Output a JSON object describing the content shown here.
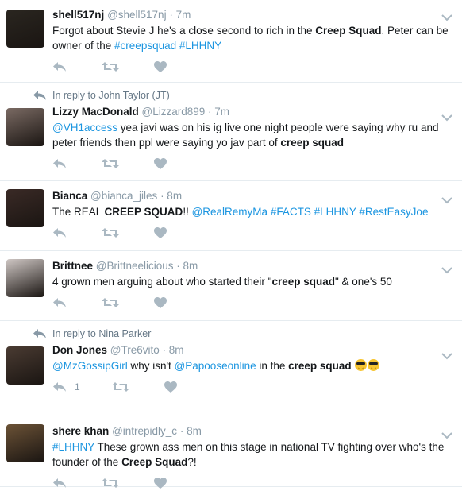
{
  "tweets": [
    {
      "reply_to": "",
      "name": "shell517nj",
      "handle": "@shell517nj",
      "time": "· 7m",
      "avatar_color": "#2a2620",
      "segments": [
        {
          "t": "Forgot about Stevie J he's a close second to rich in the "
        },
        {
          "t": "Creep Squad",
          "b": true
        },
        {
          "t": ".   Peter can be owner of the "
        },
        {
          "t": "#creepsquad",
          "l": true
        },
        {
          "t": "  "
        },
        {
          "t": "#LHHNY",
          "l": true
        }
      ],
      "reply_count": ""
    },
    {
      "reply_to": "In reply to John Taylor (JT)",
      "name": "Lizzy MacDonald",
      "handle": "@Lizzard899",
      "time": "· 7m",
      "avatar_color": "#7a6a63",
      "segments": [
        {
          "t": "@VH1access",
          "l": true
        },
        {
          "t": " yea javi was on his ig live one night people were saying why ru and peter friends then ppl were saying yo jav part of "
        },
        {
          "t": "creep squad",
          "b": true
        }
      ],
      "reply_count": ""
    },
    {
      "reply_to": "",
      "name": "Bianca",
      "handle": "@bianca_jiles",
      "time": "· 8m",
      "avatar_color": "#3a2a26",
      "segments": [
        {
          "t": "The REAL "
        },
        {
          "t": "CREEP SQUAD",
          "b": true
        },
        {
          "t": "!! "
        },
        {
          "t": "@RealRemyMa",
          "l": true
        },
        {
          "t": " "
        },
        {
          "t": "#FACTS",
          "l": true
        },
        {
          "t": " "
        },
        {
          "t": "#LHHNY",
          "l": true
        },
        {
          "t": " "
        },
        {
          "t": "#RestEasyJoe",
          "l": true
        }
      ],
      "reply_count": ""
    },
    {
      "reply_to": "",
      "name": "Brittnee",
      "handle": "@Brittneelicious",
      "time": "· 8m",
      "avatar_color": "#cfc7c4",
      "segments": [
        {
          "t": "4 grown men arguing about who started their \""
        },
        {
          "t": "creep squad",
          "b": true
        },
        {
          "t": "\" & one's 50"
        }
      ],
      "reply_count": ""
    },
    {
      "reply_to": "In reply to Nina Parker",
      "name": "Don Jones",
      "handle": "@Tre6vito",
      "time": "· 8m",
      "avatar_color": "#4a3b32",
      "segments": [
        {
          "t": "@MzGossipGirl",
          "l": true
        },
        {
          "t": " why isn't "
        },
        {
          "t": "@Papooseonline",
          "l": true
        },
        {
          "t": " in the "
        },
        {
          "t": "creep squad",
          "b": true
        },
        {
          "t": " "
        },
        {
          "emoji": "smiling-face-with-sunglasses"
        },
        {
          "emoji": "smiling-face-with-sunglasses"
        }
      ],
      "reply_count": "1"
    },
    {
      "reply_to": "",
      "name": "shere khan",
      "handle": "@intrepidly_c",
      "time": "· 8m",
      "avatar_color": "#6b5236",
      "segments": [
        {
          "t": "#LHHNY",
          "l": true
        },
        {
          "t": " These grown ass men on this stage in national TV fighting over who's the founder of the "
        },
        {
          "t": "Creep Squad",
          "b": true
        },
        {
          "t": "?!"
        }
      ],
      "reply_count": ""
    }
  ],
  "icons": {
    "reply": "reply-icon",
    "retweet": "retweet-icon",
    "like": "heart-icon",
    "more": "chevron-down-icon",
    "in_reply": "reply-arrow-icon"
  },
  "colors": {
    "link": "#1b95e0",
    "muted": "#8899a6",
    "icon": "#aab8c2",
    "divider": "#e6ecf0"
  }
}
